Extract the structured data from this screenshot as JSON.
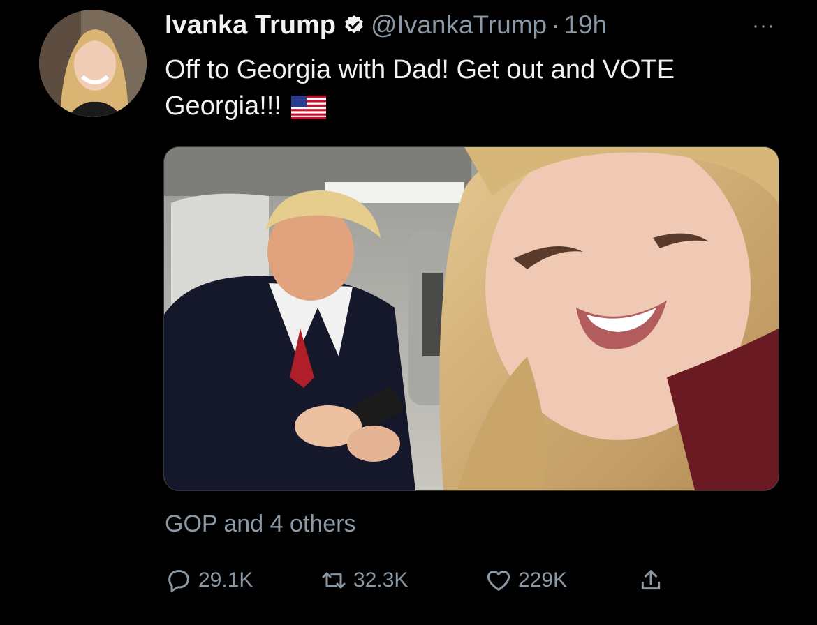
{
  "tweet": {
    "author_name": "Ivanka Trump",
    "handle": "@IvankaTrump",
    "separator": "·",
    "time": "19h",
    "more_label": "···",
    "text": "Off to Georgia with Dad! Get out and VOTE Georgia!!!",
    "social_context": "GOP and 4 others",
    "stats": {
      "replies": "29.1K",
      "retweets": "32.3K",
      "likes": "229K"
    }
  },
  "icons": {
    "verified": "verified-badge-icon",
    "flag": "us-flag-emoji",
    "reply": "reply-icon",
    "retweet": "retweet-icon",
    "like": "heart-icon",
    "share": "share-icon"
  },
  "colors": {
    "background": "#000000",
    "text": "#e7e9ea",
    "muted": "#8b98a5"
  }
}
